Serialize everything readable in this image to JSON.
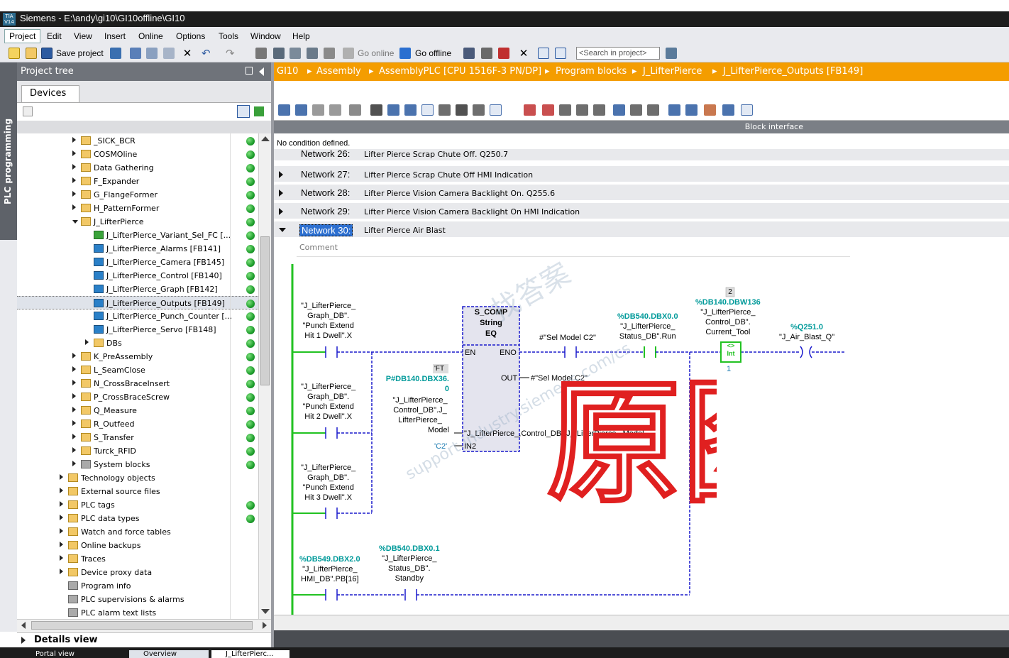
{
  "window": {
    "title": "Siemens  -  E:\\andy\\gi10\\GI10offline\\GI10",
    "logo": "TIA V14"
  },
  "menu": [
    "Project",
    "Edit",
    "View",
    "Insert",
    "Online",
    "Options",
    "Tools",
    "Window",
    "Help"
  ],
  "toolbar": {
    "save_label": "Save project",
    "go_online": "Go online",
    "go_offline": "Go offline",
    "search_placeholder": "<Search in project>"
  },
  "side_tab": "PLC programming",
  "project_tree": {
    "title": "Project tree",
    "tab": "Devices",
    "items": [
      {
        "label": "_SICK_BCR",
        "type": "folder",
        "status": true
      },
      {
        "label": "COSMOline",
        "type": "folder",
        "status": true
      },
      {
        "label": "Data Gathering",
        "type": "folder",
        "status": true
      },
      {
        "label": "F_Expander",
        "type": "folder",
        "status": true
      },
      {
        "label": "G_FlangeFormer",
        "type": "folder",
        "status": true
      },
      {
        "label": "H_PatternFormer",
        "type": "folder",
        "status": true
      },
      {
        "label": "J_LifterPierce",
        "type": "folder",
        "status": true
      },
      {
        "label": "J_LifterPierce_Variant_Sel_FC [...",
        "type": "fc",
        "status": true
      },
      {
        "label": "J_LifterPierce_Alarms [FB141]",
        "type": "fb",
        "status": true
      },
      {
        "label": "J_LifterPierce_Camera [FB145]",
        "type": "fb",
        "status": true
      },
      {
        "label": "J_LifterPierce_Control [FB140]",
        "type": "fb",
        "status": true
      },
      {
        "label": "J_LifterPierce_Graph [FB142]",
        "type": "fb",
        "status": true
      },
      {
        "label": "J_LifterPierce_Outputs [FB149]",
        "type": "fb",
        "status": true
      },
      {
        "label": "J_LifterPierce_Punch_Counter [...",
        "type": "fb",
        "status": true
      },
      {
        "label": "J_LifterPierce_Servo [FB148]",
        "type": "fb",
        "status": true
      },
      {
        "label": "DBs",
        "type": "folder",
        "status": true
      },
      {
        "label": "K_PreAssembly",
        "type": "folder",
        "status": true
      },
      {
        "label": "L_SeamClose",
        "type": "folder",
        "status": true
      },
      {
        "label": "N_CrossBraceInsert",
        "type": "folder",
        "status": true
      },
      {
        "label": "P_CrossBraceScrew",
        "type": "folder",
        "status": true
      },
      {
        "label": "Q_Measure",
        "type": "folder",
        "status": true
      },
      {
        "label": "R_Outfeed",
        "type": "folder",
        "status": true
      },
      {
        "label": "S_Transfer",
        "type": "folder",
        "status": true
      },
      {
        "label": "Turck_RFID",
        "type": "folder",
        "status": true
      },
      {
        "label": "System blocks",
        "type": "gray",
        "status": true
      },
      {
        "label": "Technology objects",
        "type": "folder",
        "status": false
      },
      {
        "label": "External source files",
        "type": "folder",
        "status": false
      },
      {
        "label": "PLC tags",
        "type": "folder",
        "status": true
      },
      {
        "label": "PLC data types",
        "type": "folder",
        "status": true
      },
      {
        "label": "Watch and force tables",
        "type": "folder",
        "status": false
      },
      {
        "label": "Online backups",
        "type": "folder",
        "status": false
      },
      {
        "label": "Traces",
        "type": "folder",
        "status": false
      },
      {
        "label": "Device proxy data",
        "type": "folder",
        "status": false
      },
      {
        "label": "Program info",
        "type": "gray",
        "status": false
      },
      {
        "label": "PLC supervisions & alarms",
        "type": "gray",
        "status": false
      },
      {
        "label": "PLC alarm text lists",
        "type": "gray",
        "status": false
      }
    ]
  },
  "details_view": "Details view",
  "bottom_tabs": [
    "Portal view",
    "Overview",
    "J_LifterPierc..."
  ],
  "breadcrumb": [
    "GI10",
    "Assembly",
    "AssemblyPLC [CPU 1516F-3 PN/DP]",
    "Program blocks",
    "J_LifterPierce",
    "J_LifterPierce_Outputs [FB149]"
  ],
  "editor": {
    "block_interface": "Block interface",
    "no_condition": "No condition defined.",
    "networks": [
      {
        "name": "Network 26:",
        "desc": "Lifter Pierce Scrap Chute Off. Q250.7"
      },
      {
        "name": "Network 27:",
        "desc": "Lifter Pierce Scrap Chute Off HMI Indication"
      },
      {
        "name": "Network 28:",
        "desc": "Lifter Pierce Vision Camera Backlight On. Q255.6"
      },
      {
        "name": "Network 29:",
        "desc": "Lifter Pierce Vision Camera Backlight On HMI Indication"
      },
      {
        "name": "Network 30:",
        "desc": "Lifter Pierce Air Blast"
      }
    ],
    "comment": "Comment",
    "ladder": {
      "c1": [
        "\"J_LifterPierce_",
        "Graph_DB\".",
        "\"Punch Extend",
        "Hit 1 Dwell\".X"
      ],
      "c2": [
        "\"J_LifterPierce_",
        "Graph_DB\".",
        "\"Punch Extend",
        "Hit 2 Dwell\".X"
      ],
      "c3": [
        "\"J_LifterPierce_",
        "Graph_DB\".",
        "\"Punch Extend",
        "Hit 3 Dwell\".X"
      ],
      "c4_addr": "%DB549.DBX2.0",
      "c4": [
        "\"J_LifterPierce_",
        "HMI_DB\".PB[16]"
      ],
      "c5_addr": "%DB540.DBX0.1",
      "c5": [
        "\"J_LifterPierce_",
        "Status_DB\".",
        "Standby"
      ],
      "box_title": "S_COMP",
      "box_type": "String",
      "box_op": "EQ",
      "en": "EN",
      "eno": "ENO",
      "out": "OUT",
      "in1": [
        "\"J_LifterPierce_",
        "Control_DB\".J_",
        "LifterPierce_",
        "Model"
      ],
      "in2": "IN2",
      "out_tag": "#\"Sel Model C2\"",
      "eno_tag": "#\"Sel Model C2\"",
      "in1_addr": "P#DB140.DBX36.",
      "in1_addr2": "0",
      "in1_ft": "'FT",
      "in2_val": "'C2'",
      "c6_addr": "%DB540.DBX0.0",
      "c6": [
        "\"J_LifterPierce_",
        "Status_DB\".Run"
      ],
      "cmp_badge": "2",
      "cmp_addr": "%DB140.DBW136",
      "cmp": [
        "\"J_LifterPierce_",
        "Control_DB\".",
        "Current_Tool"
      ],
      "cmp_op": "<>",
      "cmp_type": "Int",
      "cmp_val": "1",
      "coil_addr": "%Q251.0",
      "coil": "\"J_Air_Blast_Q\""
    }
  },
  "watermark": {
    "handwritten": "原图",
    "brand": "找答案",
    "url": "support.industry.siemens.com/cs"
  }
}
